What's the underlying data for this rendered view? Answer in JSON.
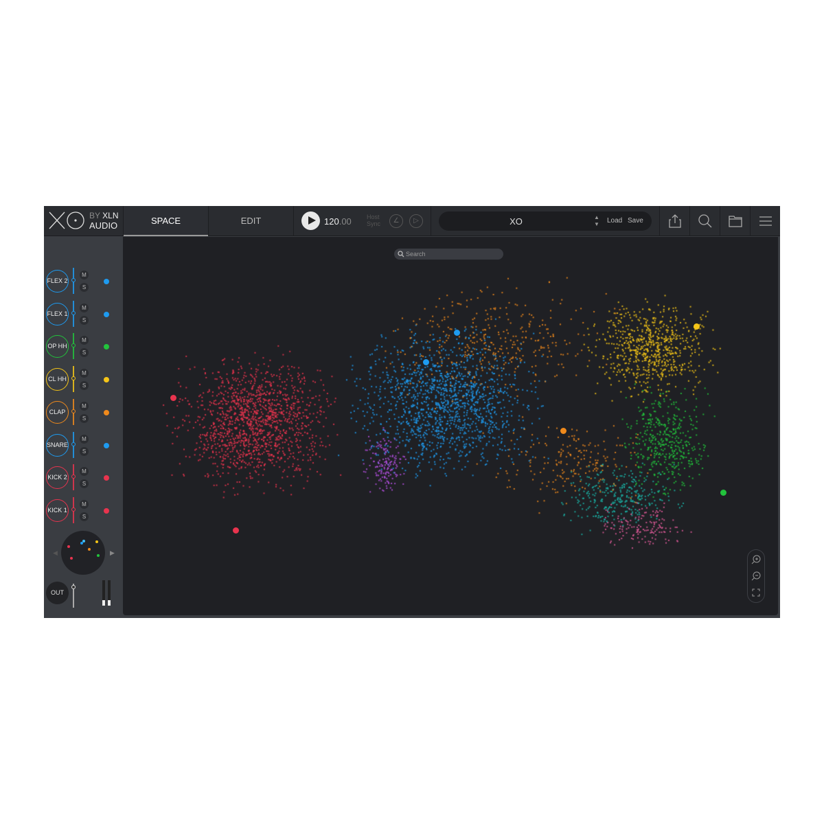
{
  "app": {
    "logo": "XO",
    "by": "BY",
    "brand": "XLN",
    "brand2": "AUDIO"
  },
  "tabs": [
    {
      "label": "SPACE",
      "active": true
    },
    {
      "label": "EDIT",
      "active": false
    }
  ],
  "transport": {
    "bpm_int": "120",
    "bpm_dec": ".00",
    "host_sync_1": "Host",
    "host_sync_2": "Sync"
  },
  "preset": {
    "name": "XO",
    "load": "Load",
    "save": "Save"
  },
  "toolbar_icons": [
    "export-icon",
    "search-icon",
    "folder-icon",
    "menu-icon"
  ],
  "search": {
    "placeholder": "Search"
  },
  "tracks": [
    {
      "label": "FLEX 2",
      "color": "#1e9bf0"
    },
    {
      "label": "FLEX 1",
      "color": "#1e9bf0"
    },
    {
      "label": "OP HH",
      "color": "#22c33c"
    },
    {
      "label": "CL HH",
      "color": "#f5c518"
    },
    {
      "label": "CLAP",
      "color": "#f08a1c"
    },
    {
      "label": "SNARE",
      "color": "#1e9bf0"
    },
    {
      "label": "KICK 2",
      "color": "#e8344e"
    },
    {
      "label": "KICK 1",
      "color": "#e8344e"
    }
  ],
  "mute_label": "M",
  "solo_label": "S",
  "out_label": "OUT",
  "colors": {
    "blue": "#1e9bf0",
    "green": "#22c33c",
    "yellow": "#f5c518",
    "orange": "#f08a1c",
    "red": "#e8344e",
    "purple": "#b44fe0",
    "teal": "#1ab5a8",
    "pink": "#e05a9a",
    "background": "#1f2024"
  }
}
